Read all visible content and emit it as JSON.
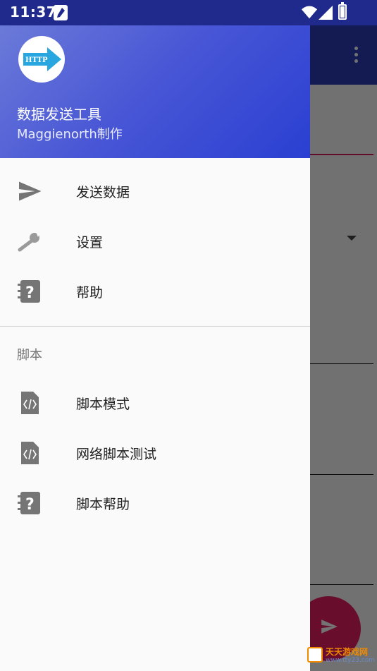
{
  "status_bar": {
    "time": "11:37"
  },
  "drawer": {
    "header": {
      "logo_text": "HTTP",
      "title": "数据发送工具",
      "subtitle": "Maggienorth制作"
    },
    "main_items": [
      {
        "label": "发送数据",
        "icon": "send-icon"
      },
      {
        "label": "设置",
        "icon": "wrench-icon"
      },
      {
        "label": "帮助",
        "icon": "help-book-icon"
      }
    ],
    "section_title": "脚本",
    "script_items": [
      {
        "label": "脚本模式",
        "icon": "code-file-icon"
      },
      {
        "label": "网络脚本测试",
        "icon": "code-file-icon"
      },
      {
        "label": "脚本帮助",
        "icon": "help-book-icon"
      }
    ]
  },
  "watermark": {
    "text": "天天游戏网",
    "url": "www.tty23.com"
  },
  "colors": {
    "header_start": "#6b7ad8",
    "header_end": "#2a3fd2",
    "status_bar": "#1f2a8c",
    "fab": "#e91e63",
    "icon_gray": "#757575"
  }
}
